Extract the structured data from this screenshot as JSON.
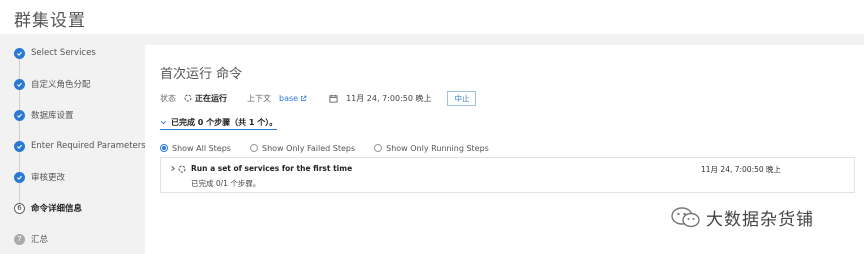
{
  "page": {
    "title": "群集设置"
  },
  "steps": [
    {
      "label": "Select Services",
      "state": "done"
    },
    {
      "label": "自定义角色分配",
      "state": "done"
    },
    {
      "label": "数据库设置",
      "state": "done"
    },
    {
      "label": "Enter Required Parameters",
      "state": "done"
    },
    {
      "label": "审核更改",
      "state": "done"
    },
    {
      "label": "命令详细信息",
      "state": "current",
      "number": "6"
    },
    {
      "label": "汇总",
      "state": "future",
      "number": "7"
    }
  ],
  "command": {
    "title": "首次运行 命令",
    "status_label": "状态",
    "status_value": "正在运行",
    "context_label": "上下文",
    "context_link": "base",
    "time": "11月 24, 7:00:50 晚上",
    "abort_label": "中止"
  },
  "summary": {
    "text": "已完成 0 个步骤（共 1 个）。"
  },
  "filters": [
    {
      "label": "Show All Steps",
      "checked": true
    },
    {
      "label": "Show Only Failed Steps",
      "checked": false
    },
    {
      "label": "Show Only Running Steps",
      "checked": false
    }
  ],
  "step_rows": [
    {
      "title": "Run a set of services for the first time",
      "sub": "已完成 0/1 个步骤。",
      "time": "11月 24, 7:00:50 晚上"
    }
  ],
  "watermark": {
    "text": "大数据杂货铺"
  },
  "colors": {
    "accent": "#2a7ad3",
    "background": "#f2f2f2"
  }
}
